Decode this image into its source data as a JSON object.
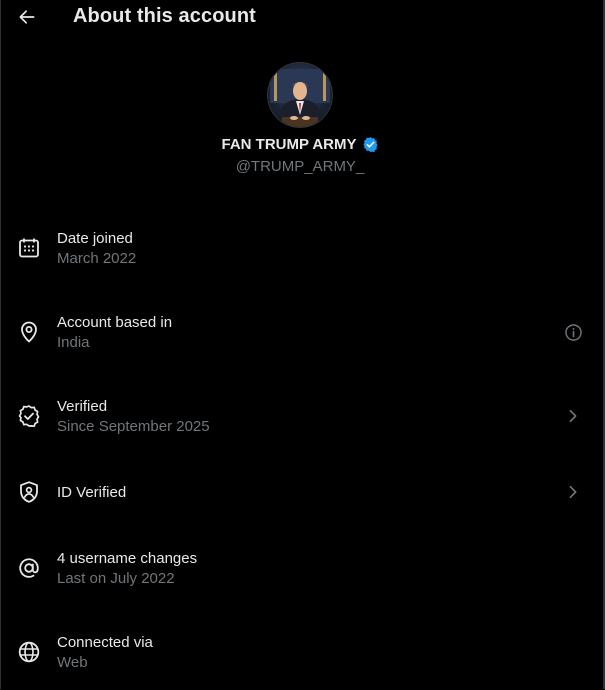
{
  "header": {
    "title": "About this account"
  },
  "profile": {
    "display_name": "FAN TRUMP ARMY",
    "handle": "@TRUMP_ARMY_"
  },
  "rows": [
    {
      "icon": "calendar-icon",
      "label": "Date joined",
      "sub": "March 2022",
      "right": ""
    },
    {
      "icon": "location-pin-icon",
      "label": "Account based in",
      "sub": "India",
      "right": "info-icon"
    },
    {
      "icon": "verified-badge-icon",
      "label": "Verified",
      "sub": "Since September 2025",
      "right": "chevron-right-icon"
    },
    {
      "icon": "id-shield-icon",
      "label": "ID Verified",
      "sub": "",
      "right": "chevron-right-icon"
    },
    {
      "icon": "at-sign-icon",
      "label": "4 username changes",
      "sub": "Last on July 2022",
      "right": ""
    },
    {
      "icon": "globe-icon",
      "label": "Connected via",
      "sub": "Web",
      "right": ""
    }
  ],
  "colors": {
    "background": "#000000",
    "text_primary": "#e7e9ea",
    "text_secondary": "#71767b",
    "verified_blue": "#1d9bf0"
  }
}
